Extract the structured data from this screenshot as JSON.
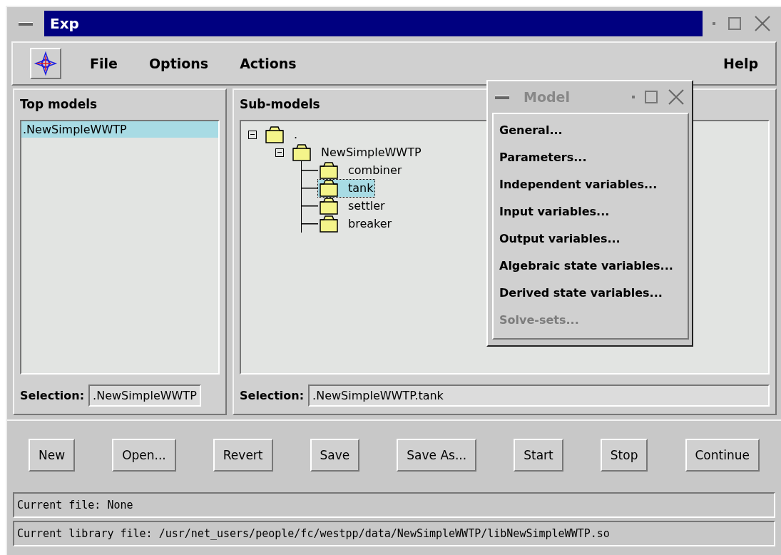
{
  "window": {
    "title": "Exp"
  },
  "menubar": {
    "items": [
      {
        "label": "File"
      },
      {
        "label": "Options"
      },
      {
        "label": "Actions"
      }
    ],
    "help": "Help"
  },
  "top_models": {
    "title": "Top models",
    "items": [
      {
        "label": ".NewSimpleWWTP",
        "selected": true
      }
    ],
    "selection_label": "Selection:",
    "selection_value": ".NewSimpleWWTP"
  },
  "sub_models": {
    "title": "Sub-models",
    "tree": [
      {
        "label": ".",
        "expanded": true,
        "selected": false,
        "children": [
          {
            "label": "NewSimpleWWTP",
            "expanded": true,
            "selected": false,
            "children": [
              {
                "label": "combiner",
                "selected": false
              },
              {
                "label": "tank",
                "selected": true
              },
              {
                "label": "settler",
                "selected": false
              },
              {
                "label": "breaker",
                "selected": false
              }
            ]
          }
        ]
      }
    ],
    "selection_label": "Selection:",
    "selection_value": ".NewSimpleWWTP.tank"
  },
  "model_window": {
    "title": "Model",
    "items": [
      {
        "label": "General...",
        "disabled": false
      },
      {
        "label": "Parameters...",
        "disabled": false
      },
      {
        "label": "Independent variables...",
        "disabled": false
      },
      {
        "label": "Input variables...",
        "disabled": false
      },
      {
        "label": "Output variables...",
        "disabled": false
      },
      {
        "label": "Algebraic state variables...",
        "disabled": false
      },
      {
        "label": "Derived state variables...",
        "disabled": false
      },
      {
        "label": "Solve-sets...",
        "disabled": true
      }
    ]
  },
  "buttons": [
    "New",
    "Open...",
    "Revert",
    "Save",
    "Save As...",
    "Start",
    "Stop",
    "Continue"
  ],
  "status": {
    "current_file": "Current file: None",
    "library_file": "Current library file: /usr/net_users/people/fc/westpp/data/NewSimpleWWTP/libNewSimpleWWTP.so"
  }
}
